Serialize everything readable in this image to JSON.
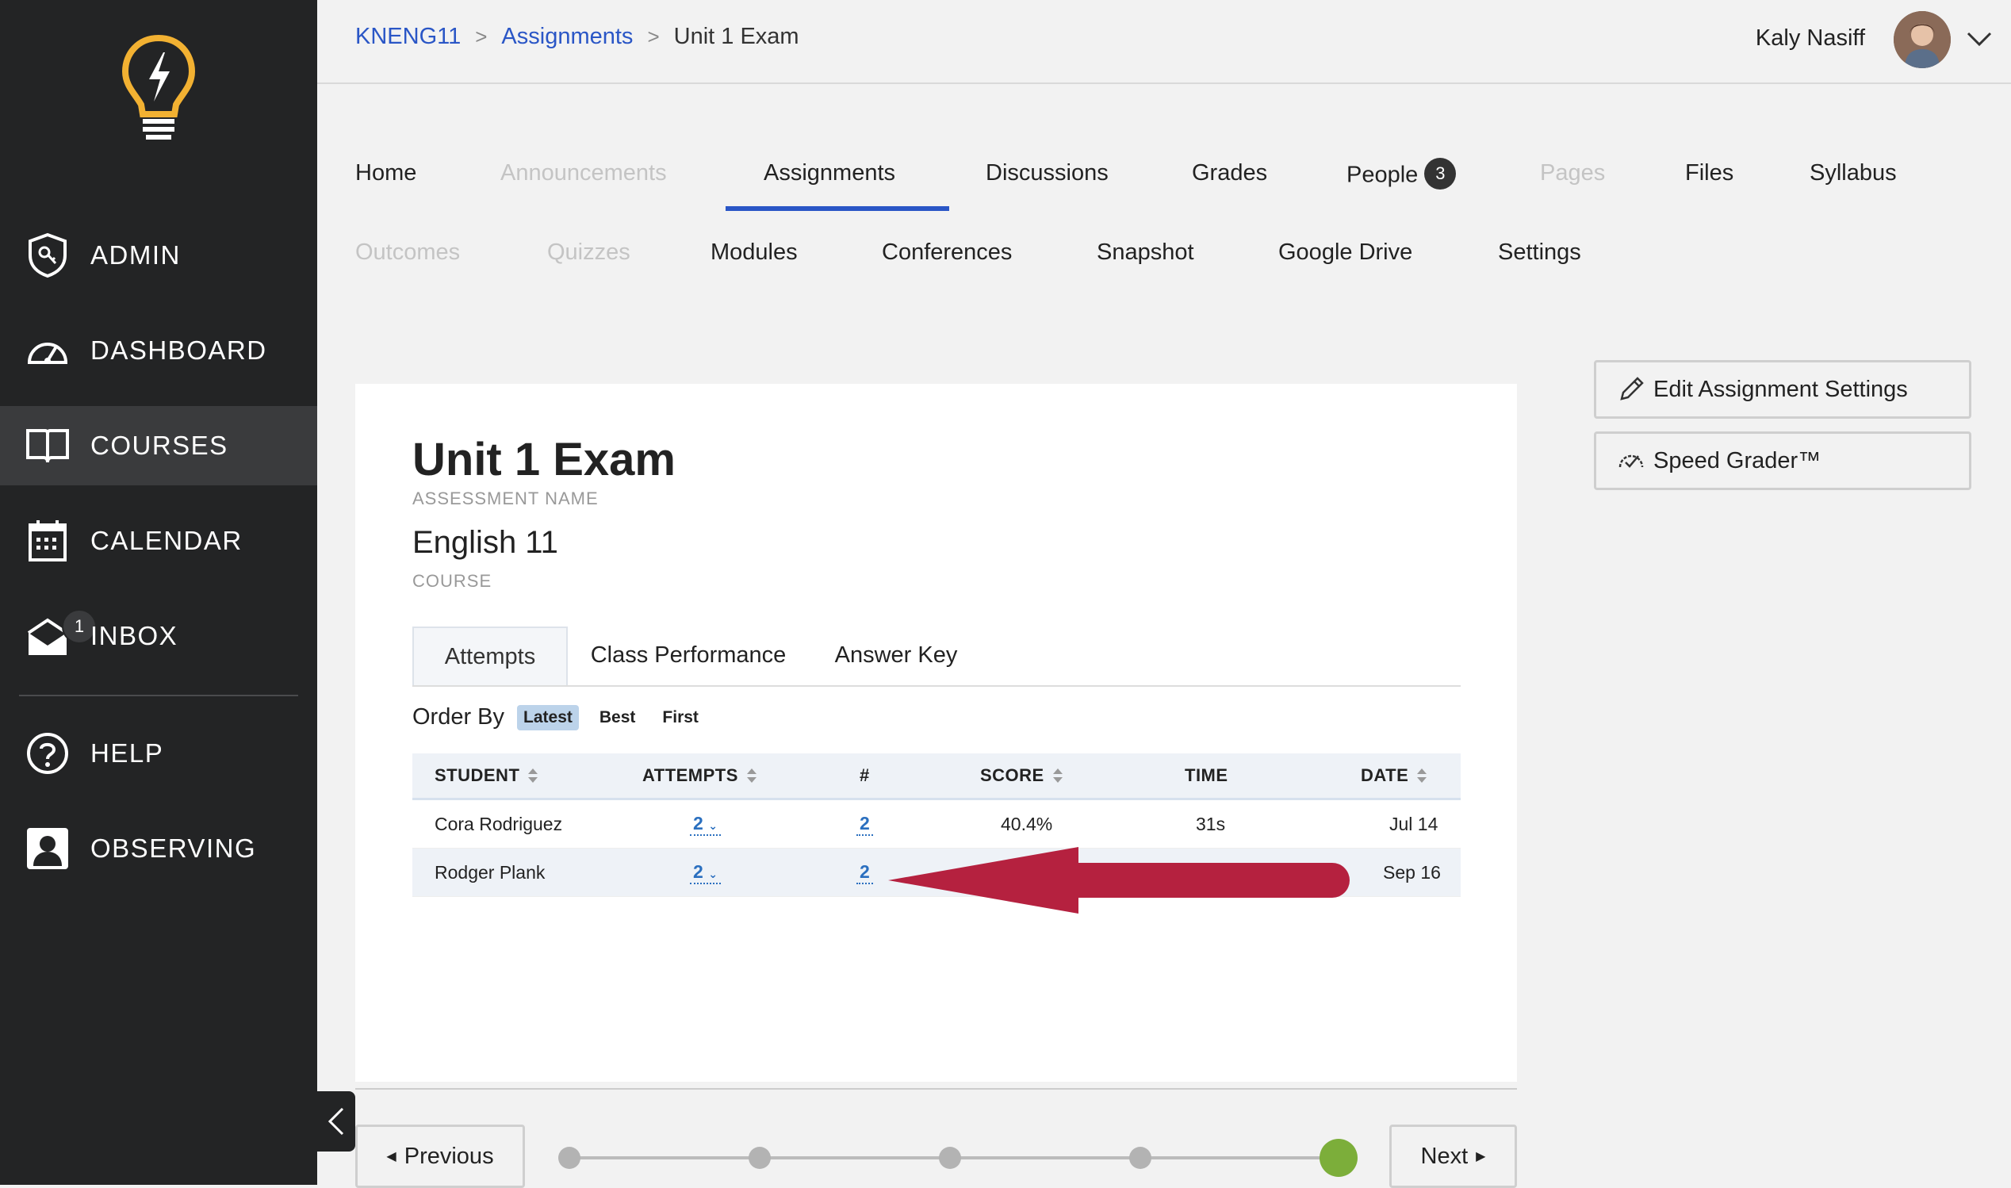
{
  "sidebar": {
    "items": [
      {
        "label": "ADMIN",
        "icon": "shield-key-icon"
      },
      {
        "label": "DASHBOARD",
        "icon": "speedometer-icon"
      },
      {
        "label": "COURSES",
        "icon": "book-icon",
        "active": true
      },
      {
        "label": "CALENDAR",
        "icon": "calendar-icon"
      },
      {
        "label": "INBOX",
        "icon": "envelope-icon",
        "badge": "1"
      },
      {
        "label": "HELP",
        "icon": "question-icon"
      },
      {
        "label": "OBSERVING",
        "icon": "person-icon"
      }
    ],
    "accent": "#f2b132"
  },
  "breadcrumb": {
    "course": "KNENG11",
    "section": "Assignments",
    "current": "Unit 1 Exam"
  },
  "user": {
    "name": "Kaly Nasiff"
  },
  "course_nav": {
    "row1": [
      "Home",
      "Announcements",
      "Assignments",
      "Discussions",
      "Grades",
      "People",
      "Pages",
      "Files",
      "Syllabus"
    ],
    "row2": [
      "Outcomes",
      "Quizzes",
      "Modules",
      "Conferences",
      "Snapshot",
      "Google Drive",
      "Settings"
    ],
    "people_badge": "3",
    "active": "Assignments",
    "disabled": [
      "Announcements",
      "Pages",
      "Outcomes",
      "Quizzes"
    ]
  },
  "assessment": {
    "name": "Unit 1 Exam",
    "name_caption": "ASSESSMENT NAME",
    "course": "English 11",
    "course_caption": "COURSE"
  },
  "tabs": [
    "Attempts",
    "Class Performance",
    "Answer Key"
  ],
  "order_by": {
    "label": "Order By",
    "options": [
      "Latest",
      "Best",
      "First"
    ],
    "selected": "Latest"
  },
  "table": {
    "columns": [
      "STUDENT",
      "ATTEMPTS",
      "#",
      "SCORE",
      "TIME",
      "DATE"
    ],
    "rows": [
      {
        "student": "Cora Rodriguez",
        "attempts": "2",
        "num": "2",
        "score": "40.4%",
        "time": "31s",
        "date": "Jul 14"
      },
      {
        "student": "Rodger Plank",
        "attempts": "2",
        "num": "2",
        "score": "",
        "time": "",
        "date": "Sep 16"
      }
    ]
  },
  "actions": {
    "edit": "Edit Assignment Settings",
    "speed_grader": "Speed Grader™"
  },
  "pager": {
    "previous": "Previous",
    "next": "Next",
    "steps": 5,
    "current_step": 5
  },
  "colors": {
    "link": "#2a56c6",
    "arrow": "#b5213f",
    "progress_current": "#7cae3a"
  }
}
